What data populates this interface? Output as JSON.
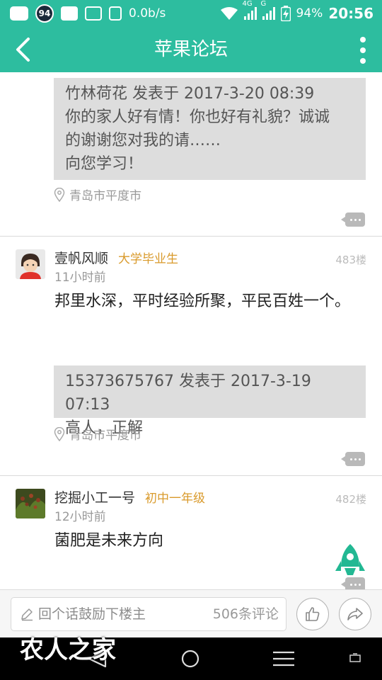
{
  "status_bar": {
    "badge": "94",
    "speed": "0.0b/s",
    "net_4g": "4G",
    "net_g": "G",
    "battery": "94%",
    "time": "20:56"
  },
  "app_bar": {
    "title": "苹果论坛"
  },
  "posts": [
    {
      "quote_lines": [
        "竹林荷花 发表于 2017-3-20 08:39",
        "你的家人好有情！你也好有礼貌？诚诚",
        "的谢谢您对我的请……",
        "向您学习！"
      ],
      "location": "青岛市平度市"
    },
    {
      "username": "壹帆风顺",
      "level": "大学毕业生",
      "time": "11小时前",
      "floor": "483楼",
      "text": "邦里水深，平时经验所聚，平民百姓一个。",
      "quote_lines": [
        "15373675767 发表于 2017-3-19 07:13",
        "高人，正解"
      ],
      "location": "青岛市平度市"
    },
    {
      "username": "挖掘小工一号",
      "level": "初中一年级",
      "time": "12小时前",
      "floor": "482楼",
      "text": "菌肥是未来方向"
    }
  ],
  "bottom_bar": {
    "reply_placeholder": "回个话鼓励下楼主",
    "comment_count": "506条评论"
  },
  "watermark": "农人之家",
  "colors": {
    "accent": "#2dbd9f",
    "level": "#d99a2b",
    "quote_bg": "#dddddd"
  }
}
